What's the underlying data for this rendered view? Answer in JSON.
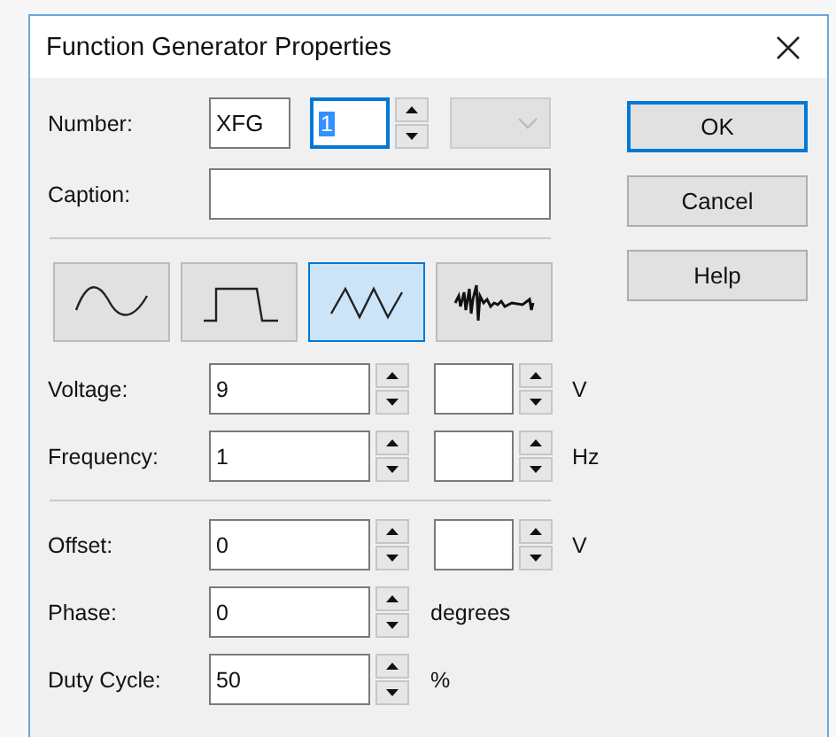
{
  "window": {
    "title": "Function Generator Properties"
  },
  "number": {
    "label": "Number:",
    "prefix": "XFG",
    "value": "1",
    "focused": true,
    "dropdown_disabled": true
  },
  "caption": {
    "label": "Caption:"
  },
  "waveforms": [
    {
      "kind": "sine",
      "selected": false
    },
    {
      "kind": "square",
      "selected": false
    },
    {
      "kind": "triangle",
      "selected": true
    },
    {
      "kind": "noise",
      "selected": false
    }
  ],
  "param_groups": [
    [
      {
        "label": "Voltage:",
        "value": "9",
        "kind": "scaled",
        "unit": "V"
      },
      {
        "label": "Frequency:",
        "value": "1",
        "kind": "scaled",
        "unit": "Hz"
      }
    ],
    [
      {
        "label": "Offset:",
        "value": "0",
        "kind": "scaled",
        "unit": "V"
      },
      {
        "label": "Phase:",
        "value": "0",
        "kind": "plain",
        "unit": "degrees"
      },
      {
        "label": "Duty Cycle:",
        "value": "50",
        "kind": "plain",
        "unit": "%"
      }
    ]
  ],
  "buttons": [
    {
      "label": "OK",
      "default": true
    },
    {
      "label": "Cancel",
      "default": false
    },
    {
      "label": "Help",
      "default": false
    }
  ]
}
